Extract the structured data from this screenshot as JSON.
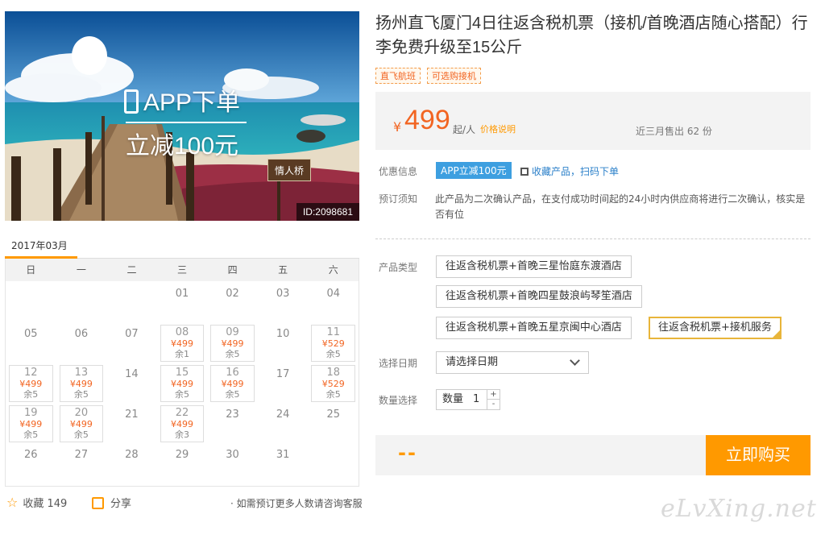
{
  "hero": {
    "promo_line1": "APP下单",
    "promo_line2": "立减100元",
    "sign_text": "情人桥",
    "image_id": "ID:2098681"
  },
  "calendar": {
    "month": "2017年03月",
    "weekdays": [
      "日",
      "一",
      "二",
      "三",
      "四",
      "五",
      "六"
    ],
    "days": [
      {
        "num": "",
        "price": "",
        "left": ""
      },
      {
        "num": "",
        "price": "",
        "left": ""
      },
      {
        "num": "",
        "price": "",
        "left": ""
      },
      {
        "num": "01",
        "price": "",
        "left": ""
      },
      {
        "num": "02",
        "price": "",
        "left": ""
      },
      {
        "num": "03",
        "price": "",
        "left": ""
      },
      {
        "num": "04",
        "price": "",
        "left": ""
      },
      {
        "num": "05",
        "price": "",
        "left": ""
      },
      {
        "num": "06",
        "price": "",
        "left": ""
      },
      {
        "num": "07",
        "price": "",
        "left": ""
      },
      {
        "num": "08",
        "price": "¥499",
        "left": "余1"
      },
      {
        "num": "09",
        "price": "¥499",
        "left": "余5"
      },
      {
        "num": "10",
        "price": "",
        "left": ""
      },
      {
        "num": "11",
        "price": "¥529",
        "left": "余5"
      },
      {
        "num": "12",
        "price": "¥499",
        "left": "余5"
      },
      {
        "num": "13",
        "price": "¥499",
        "left": "余5"
      },
      {
        "num": "14",
        "price": "",
        "left": ""
      },
      {
        "num": "15",
        "price": "¥499",
        "left": "余5"
      },
      {
        "num": "16",
        "price": "¥499",
        "left": "余5"
      },
      {
        "num": "17",
        "price": "",
        "left": ""
      },
      {
        "num": "18",
        "price": "¥529",
        "left": "余5"
      },
      {
        "num": "19",
        "price": "¥499",
        "left": "余5"
      },
      {
        "num": "20",
        "price": "¥499",
        "left": "余5"
      },
      {
        "num": "21",
        "price": "",
        "left": ""
      },
      {
        "num": "22",
        "price": "¥499",
        "left": "余3"
      },
      {
        "num": "23",
        "price": "",
        "left": ""
      },
      {
        "num": "24",
        "price": "",
        "left": ""
      },
      {
        "num": "25",
        "price": "",
        "left": ""
      },
      {
        "num": "26",
        "price": "",
        "left": ""
      },
      {
        "num": "27",
        "price": "",
        "left": ""
      },
      {
        "num": "28",
        "price": "",
        "left": ""
      },
      {
        "num": "29",
        "price": "",
        "left": ""
      },
      {
        "num": "30",
        "price": "",
        "left": ""
      },
      {
        "num": "31",
        "price": "",
        "left": ""
      }
    ]
  },
  "actions": {
    "favorite_label": "收藏",
    "favorite_count": "149",
    "share_label": "分享",
    "contact_note": "· 如需预订更多人数请咨询客服"
  },
  "product": {
    "title": "扬州直飞厦门4日往返含税机票（接机/首晚酒店随心搭配）行李免费升级至15公斤",
    "tags": [
      "直飞航班",
      "可选购接机"
    ],
    "currency": "¥",
    "price": "499",
    "price_unit": "起/人",
    "price_explain": "价格说明",
    "sold": "近三月售出 62 份"
  },
  "discount": {
    "label": "优惠信息",
    "badge": "APP立减100元",
    "qr_link": "收藏产品，扫码下单"
  },
  "notice": {
    "label": "预订须知",
    "text": "此产品为二次确认产品，在支付成功时间起的24小时内供应商将进行二次确认，核实是否有位"
  },
  "product_type": {
    "label": "产品类型",
    "options": [
      "往返含税机票+首晚三星怡庭东渡酒店",
      "往返含税机票+首晚四星鼓浪屿琴笙酒店",
      "往返含税机票+首晚五星京闽中心酒店",
      "往返含税机票+接机服务"
    ],
    "selected_index": 3
  },
  "date": {
    "label": "选择日期",
    "placeholder": "请选择日期"
  },
  "quantity": {
    "label": "数量选择",
    "inner_label": "数量",
    "value": "1",
    "plus": "+",
    "minus": "-"
  },
  "purchase": {
    "total": "--",
    "buy_label": "立即购买"
  },
  "watermark": "eLvXing.net",
  "colors": {
    "accent": "#ff9900",
    "price": "#f26522",
    "link": "#2a7fc9",
    "badge": "#3d9fe0"
  }
}
